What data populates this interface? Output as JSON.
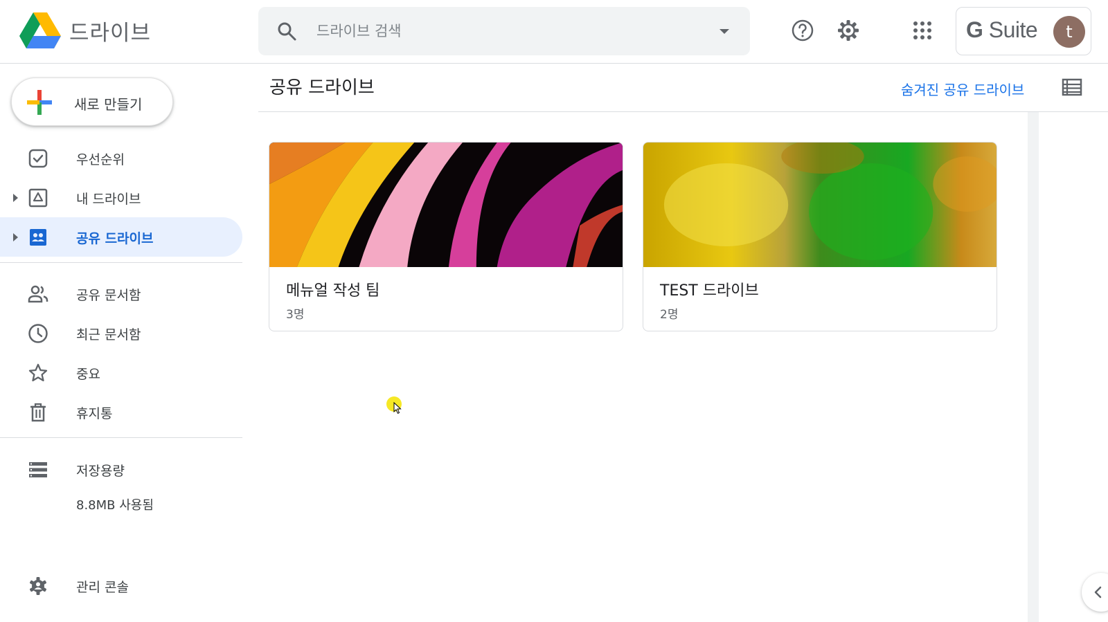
{
  "app": {
    "title": "드라이브",
    "search_placeholder": "드라이브 검색",
    "gsuite_label": "Suite",
    "gsuite_g": "G",
    "avatar_initial": "t"
  },
  "header_icons": [
    "help-icon",
    "settings-icon",
    "apps-grid-icon"
  ],
  "sidebar": {
    "new_label": "새로 만들기",
    "items": [
      {
        "label": "우선순위",
        "icon": "priority-icon"
      },
      {
        "label": "내 드라이브",
        "icon": "my-drive-icon"
      },
      {
        "label": "공유 드라이브",
        "icon": "shared-drives-icon",
        "active": true
      },
      {
        "label": "공유 문서함",
        "icon": "shared-with-me-icon"
      },
      {
        "label": "최근 문서함",
        "icon": "recent-icon"
      },
      {
        "label": "중요",
        "icon": "star-icon"
      },
      {
        "label": "휴지통",
        "icon": "trash-icon"
      },
      {
        "label": "저장용량",
        "icon": "storage-icon"
      },
      {
        "label": "관리 콘솔",
        "icon": "admin-console-icon"
      }
    ],
    "storage_used": "8.8MB 사용됨"
  },
  "main": {
    "title": "공유 드라이브",
    "hidden_link": "숨겨진 공유 드라이브",
    "cards": [
      {
        "name": "메뉴얼 작성 팀",
        "members": "3명"
      },
      {
        "name": "TEST 드라이브",
        "members": "2명"
      }
    ]
  },
  "colors": {
    "accent": "#1a73e8",
    "active_bg": "#e8f0fe",
    "active_text": "#1967d2"
  }
}
